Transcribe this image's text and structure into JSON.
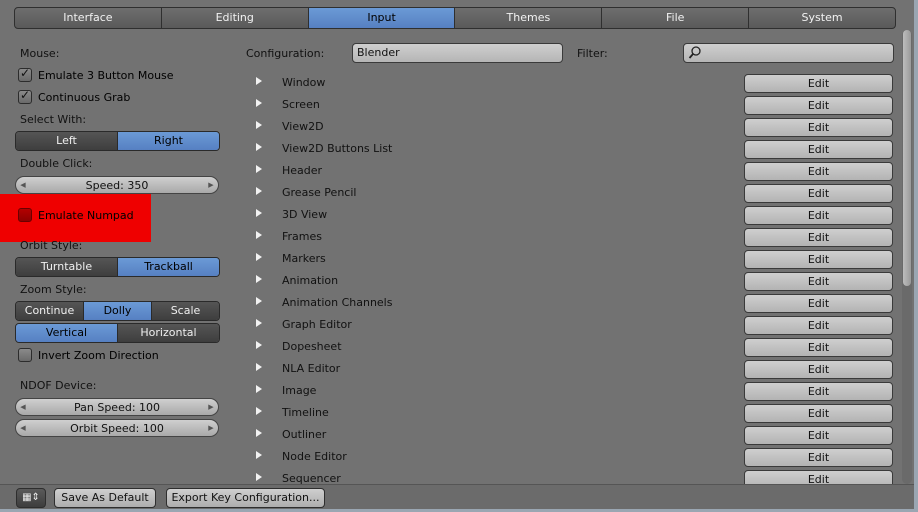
{
  "tabs": [
    {
      "label": "Interface",
      "active": false
    },
    {
      "label": "Editing",
      "active": false
    },
    {
      "label": "Input",
      "active": true
    },
    {
      "label": "Themes",
      "active": false
    },
    {
      "label": "File",
      "active": false
    },
    {
      "label": "System",
      "active": false
    }
  ],
  "left": {
    "mouse_label": "Mouse:",
    "emulate3": "Emulate 3 Button Mouse",
    "continuous_grab": "Continuous Grab",
    "select_with_label": "Select With:",
    "select_left": "Left",
    "select_right": "Right",
    "double_click_label": "Double Click:",
    "speed": "Speed: 350",
    "emulate_numpad": "Emulate Numpad",
    "orbit_style_label": "Orbit Style:",
    "turntable": "Turntable",
    "trackball": "Trackball",
    "zoom_style_label": "Zoom Style:",
    "zoom_continue": "Continue",
    "zoom_dolly": "Dolly",
    "zoom_scale": "Scale",
    "vertical": "Vertical",
    "horizontal": "Horizontal",
    "invert_zoom": "Invert Zoom Direction",
    "ndof_label": "NDOF Device:",
    "pan_speed": "Pan Speed: 100",
    "orbit_speed": "Orbit Speed: 100"
  },
  "config": {
    "label": "Configuration:",
    "value": "Blender",
    "filter_label": "Filter:",
    "filter_value": ""
  },
  "keymaps": [
    "Window",
    "Screen",
    "View2D",
    "View2D Buttons List",
    "Header",
    "Grease Pencil",
    "3D View",
    "Frames",
    "Markers",
    "Animation",
    "Animation Channels",
    "Graph Editor",
    "Dopesheet",
    "NLA Editor",
    "Image",
    "Timeline",
    "Outliner",
    "Node Editor",
    "Sequencer"
  ],
  "edit_label": "Edit",
  "bottom": {
    "save_default": "Save As Default",
    "export_keys": "Export Key Configuration..."
  },
  "icons": {
    "search": "magnifier-icon",
    "disclosure": "triangle-right-icon",
    "menu": "editor-type-icon"
  }
}
